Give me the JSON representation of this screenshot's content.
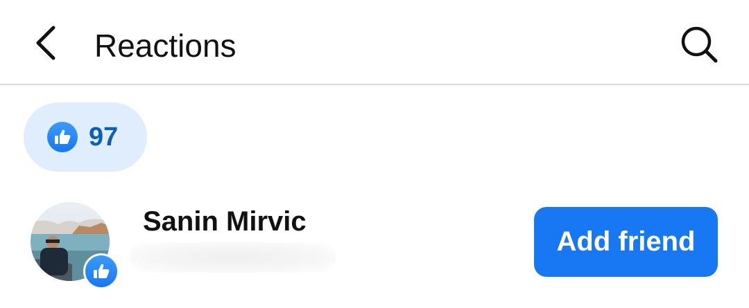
{
  "header": {
    "title": "Reactions",
    "back_icon": "back-arrow-icon",
    "search_icon": "search-icon"
  },
  "tabs": [
    {
      "icon": "like-icon",
      "count": "97",
      "selected": true
    }
  ],
  "reactors": [
    {
      "name": "Sanin Mirvic",
      "reaction": "like",
      "action_label": "Add friend"
    }
  ],
  "colors": {
    "accent": "#1877f2",
    "pill_bg": "#dfedfc",
    "pill_text": "#0b5fb9"
  }
}
